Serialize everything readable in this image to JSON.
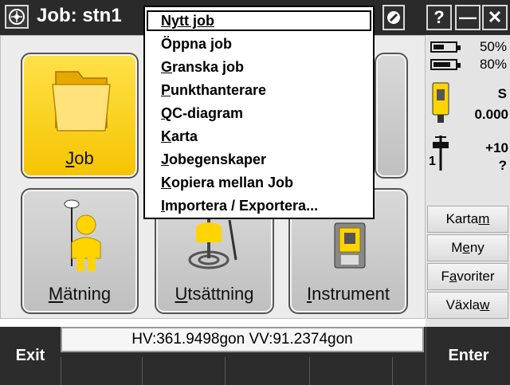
{
  "titlebar": {
    "title": "Job: stn1",
    "help_label": "?",
    "minimize_label": "—",
    "close_label": "✕"
  },
  "menu": {
    "items": [
      {
        "label": "Nytt job",
        "hotkey_index": 0,
        "selected": true
      },
      {
        "label": "Öppna job",
        "hotkey_index": null
      },
      {
        "label": "Granska job",
        "hotkey_index": 0
      },
      {
        "label": "Punkthanterare",
        "hotkey_index": 0
      },
      {
        "label": "QC-diagram",
        "hotkey_index": 0
      },
      {
        "label": "Karta",
        "hotkey_index": 0
      },
      {
        "label": "Jobegenskaper",
        "hotkey_index": 0
      },
      {
        "label": "Kopiera mellan Job",
        "hotkey_index": 0
      },
      {
        "label": "Importera / Exportera...",
        "hotkey_index": 0
      }
    ]
  },
  "tiles": [
    {
      "id": "job",
      "label_pre": "",
      "label_hot": "J",
      "label_post": "ob",
      "icon": "folder-icon"
    },
    {
      "id": "matning",
      "label_pre": "",
      "label_hot": "M",
      "label_post": "ätning",
      "icon": "surveyor-gps-icon"
    },
    {
      "id": "utsattning",
      "label_pre": "",
      "label_hot": "U",
      "label_post": "tsättning",
      "icon": "stakeout-icon"
    },
    {
      "id": "instrument",
      "label_pre": "",
      "label_hot": "I",
      "label_post": "nstrument",
      "icon": "total-station-icon"
    }
  ],
  "status": {
    "battery1": "50%",
    "battery2": "80%",
    "battery1_level": 0.5,
    "battery2_level": 0.8,
    "instrument_mode": "S",
    "instrument_value": "0.000",
    "target_value": "+10",
    "target_id": "1",
    "target_unknown": "?"
  },
  "rightbuttons": [
    {
      "pre": "Karta ",
      "hot": "m",
      "post": ""
    },
    {
      "pre": "M",
      "hot": "e",
      "post": "ny"
    },
    {
      "pre": "F",
      "hot": "a",
      "post": "voriter"
    },
    {
      "pre": "Växla ",
      "hot": "w",
      "post": ""
    }
  ],
  "bottom": {
    "hv_readout": "HV:361.9498gon  VV:91.2374gon",
    "exit_label": "Exit",
    "enter_label": "Enter"
  },
  "colors": {
    "tile_yellow": "#f5c400",
    "titlebar": "#2a2a2a",
    "accent_yellow": "#ffd400"
  }
}
